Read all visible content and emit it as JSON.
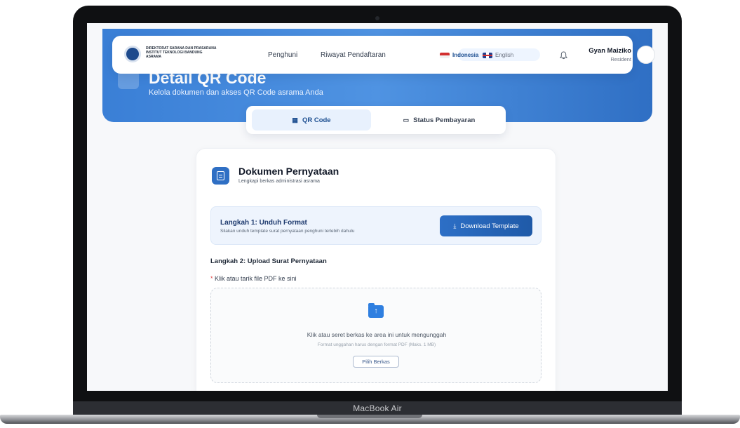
{
  "device": {
    "label": "MacBook Air"
  },
  "header": {
    "logo_text_line1": "DIREKTORAT SARANA DAN PRASARANA",
    "logo_text_line2": "INSTITUT TEKNOLOGI BANDUNG",
    "logo_text_line3": "ASRAMA",
    "nav_items": [
      "Penghuni",
      "Riwayat Pendaftaran"
    ],
    "languages": {
      "active": "Indonesia",
      "other": "English"
    },
    "user": {
      "name": "Gyan Maiziko",
      "role": "Resident"
    }
  },
  "hero": {
    "title": "Detail QR Code",
    "subtitle": "Kelola dokumen dan akses QR Code asrama Anda"
  },
  "tabs": [
    {
      "label": "QR Code",
      "icon": "qr-icon",
      "active": true
    },
    {
      "label": "Status Pembayaran",
      "icon": "card-icon",
      "active": false
    }
  ],
  "card": {
    "title": "Dokumen Pernyataan",
    "subtitle": "Lengkapi berkas administrasi asrama",
    "step1": {
      "title": "Langkah 1: Unduh Format",
      "description": "Silakan unduh template surat pernyataan penghuni terlebih dahulu",
      "button_label": "Download Template"
    },
    "step2": {
      "title": "Langkah 2: Upload Surat Pernyataan",
      "required_mark": "*",
      "field_label": "Klik atau tarik file PDF ke sini",
      "dropzone_text": "Klik atau seret berkas ke area ini untuk mengunggah",
      "dropzone_hint": "Format unggahan harus dengan format PDF (Maks. 1 MB)",
      "browse_button": "Pilih Berkas"
    }
  },
  "colors": {
    "primary": "#2f6fc4",
    "hero_gradient_start": "#3a7fd6",
    "hero_gradient_end": "#2f6fc4",
    "required": "#e04a4a"
  }
}
